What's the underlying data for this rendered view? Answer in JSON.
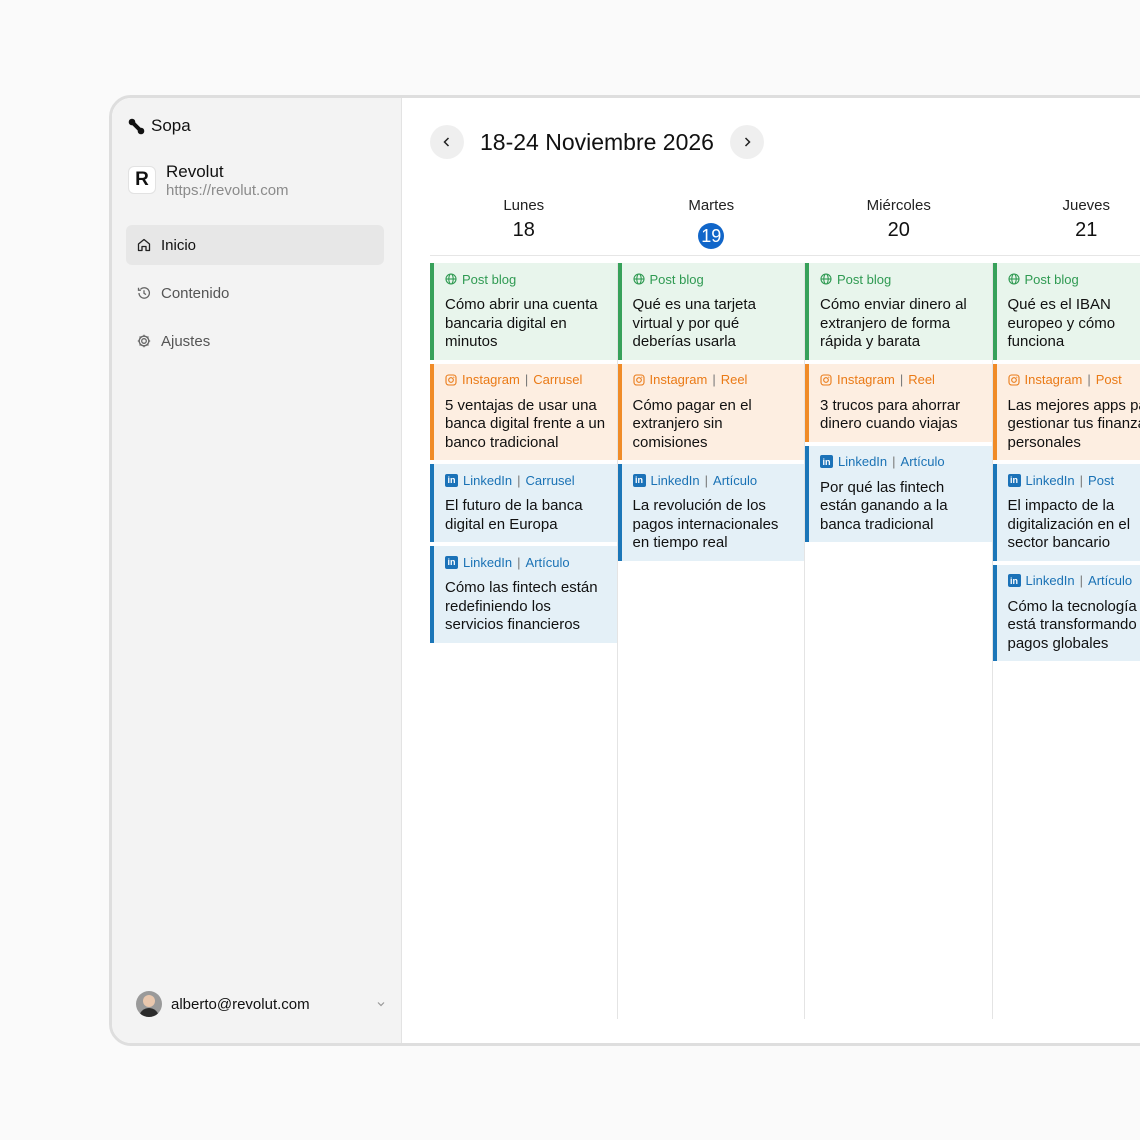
{
  "brand": {
    "name": "Sopa"
  },
  "org": {
    "logo_letter": "R",
    "name": "Revolut",
    "url": "https://revolut.com"
  },
  "nav": [
    {
      "label": "Inicio",
      "icon": "home-icon",
      "active": true
    },
    {
      "label": "Contenido",
      "icon": "history-icon",
      "active": false
    },
    {
      "label": "Ajustes",
      "icon": "gear-icon",
      "active": false
    }
  ],
  "user": {
    "email": "alberto@revolut.com"
  },
  "calendar": {
    "range_title": "18-24 Noviembre 2026",
    "days": [
      {
        "name": "Lunes",
        "number": "18",
        "today": false
      },
      {
        "name": "Martes",
        "number": "19",
        "today": true
      },
      {
        "name": "Miércoles",
        "number": "20",
        "today": false
      },
      {
        "name": "Jueves",
        "number": "21",
        "today": false
      }
    ],
    "columns": [
      [
        {
          "type": "blog",
          "platform": "Post blog",
          "format": "",
          "title": "Cómo abrir una cuenta bancaria digital en minutos"
        },
        {
          "type": "ig",
          "platform": "Instagram",
          "format": "Carrusel",
          "title": "5 ventajas de usar una banca digital frente a un banco tradicional"
        },
        {
          "type": "li",
          "platform": "LinkedIn",
          "format": "Carrusel",
          "title": "El futuro de la banca digital en Europa"
        },
        {
          "type": "li",
          "platform": "LinkedIn",
          "format": "Artículo",
          "title": "Cómo las fintech están redefiniendo los servicios financieros"
        }
      ],
      [
        {
          "type": "blog",
          "platform": "Post blog",
          "format": "",
          "title": "Qué es una tarjeta virtual y por qué deberías usarla"
        },
        {
          "type": "ig",
          "platform": "Instagram",
          "format": "Reel",
          "title": "Cómo pagar en el extranjero sin comisiones"
        },
        {
          "type": "li",
          "platform": "LinkedIn",
          "format": "Artículo",
          "title": "La revolución de los pagos internacionales en tiempo real"
        }
      ],
      [
        {
          "type": "blog",
          "platform": "Post blog",
          "format": "",
          "title": "Cómo enviar dinero al extranjero de forma rápida y barata"
        },
        {
          "type": "ig",
          "platform": "Instagram",
          "format": "Reel",
          "title": "3 trucos para ahorrar dinero cuando viajas"
        },
        {
          "type": "li",
          "platform": "LinkedIn",
          "format": "Artículo",
          "title": "Por qué las fintech están ganando a la banca tradicional"
        }
      ],
      [
        {
          "type": "blog",
          "platform": "Post blog",
          "format": "",
          "title": "Qué es el IBAN europeo y cómo funciona"
        },
        {
          "type": "ig",
          "platform": "Instagram",
          "format": "Post",
          "title": "Las mejores apps para gestionar tus finanzas personales"
        },
        {
          "type": "li",
          "platform": "LinkedIn",
          "format": "Post",
          "title": "El impacto de la digitalización en el sector bancario"
        },
        {
          "type": "li",
          "platform": "LinkedIn",
          "format": "Artículo",
          "title": "Cómo la tecnología está transformando los pagos globales"
        }
      ]
    ]
  }
}
